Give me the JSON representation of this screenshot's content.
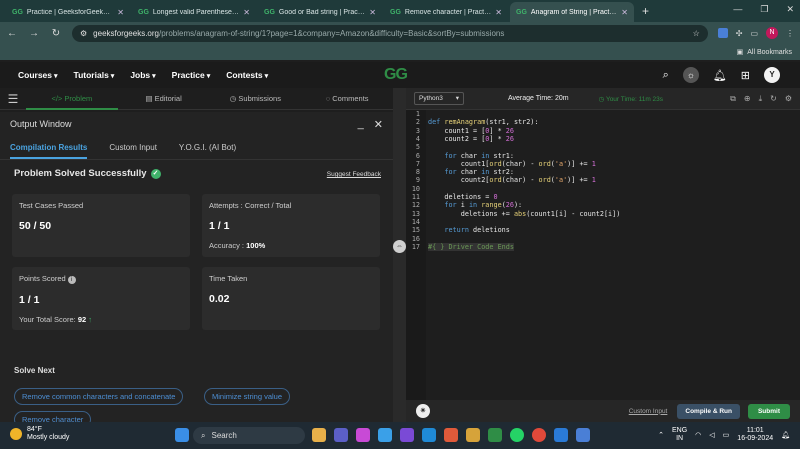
{
  "browser": {
    "tabs": [
      {
        "title": "Practice | GeeksforGeeks | A co",
        "active": false
      },
      {
        "title": "Longest valid Parentheses | Pra",
        "active": false
      },
      {
        "title": "Good or Bad string | Practice | G",
        "active": false
      },
      {
        "title": "Remove character | Practice | Ge",
        "active": false
      },
      {
        "title": "Anagram of String | Practice | Ge",
        "active": true
      }
    ],
    "new_tab": "+",
    "url_host": "geeksforgeeks.org",
    "url_path": "/problems/anagram-of-string/1?page=1&company=Amazon&difficulty=Basic&sortBy=submissions",
    "profile_letter": "N",
    "all_bookmarks": "All Bookmarks"
  },
  "header": {
    "menu": [
      "Courses",
      "Tutorials",
      "Jobs",
      "Practice",
      "Contests"
    ],
    "logo": "GG",
    "user_letter": "Y"
  },
  "left_tabs": [
    "Problem",
    "Editorial",
    "Submissions",
    "Comments"
  ],
  "output": {
    "title": "Output Window",
    "tabs": [
      "Compilation Results",
      "Custom Input",
      "Y.O.G.I. (AI Bot)"
    ],
    "status": "Problem Solved Successfully",
    "suggest_feedback": "Suggest Feedback",
    "cards": {
      "test_cases_label": "Test Cases Passed",
      "test_cases_value": "50 / 50",
      "attempts_label": "Attempts : Correct / Total",
      "attempts_value": "1 / 1",
      "accuracy_label": "Accuracy :",
      "accuracy_value": "100%",
      "points_label": "Points Scored",
      "points_value": "1 / 1",
      "total_score_label": "Your Total Score:",
      "total_score_value": "92",
      "time_label": "Time Taken",
      "time_value": "0.02"
    },
    "solve_next_label": "Solve Next",
    "solve_next": [
      "Remove common characters and concatenate",
      "Minimize string value",
      "Remove character"
    ]
  },
  "editor": {
    "language": "Python3",
    "average_time": "Average Time: 20m",
    "your_time": "Your Time: 11m 23s",
    "line_numbers": [
      "1",
      "2",
      "3",
      "4",
      "5",
      "6",
      "7",
      "8",
      "9",
      "10",
      "11",
      "12",
      "13",
      "14",
      "15",
      "16",
      "17"
    ],
    "custom_input": "Custom Input",
    "compile_run": "Compile & Run",
    "submit": "Submit"
  },
  "taskbar": {
    "temp": "84°F",
    "weather": "Mostly cloudy",
    "search": "Search",
    "lang1": "ENG",
    "lang2": "IN",
    "time": "11:01",
    "date": "16-09-2024"
  }
}
